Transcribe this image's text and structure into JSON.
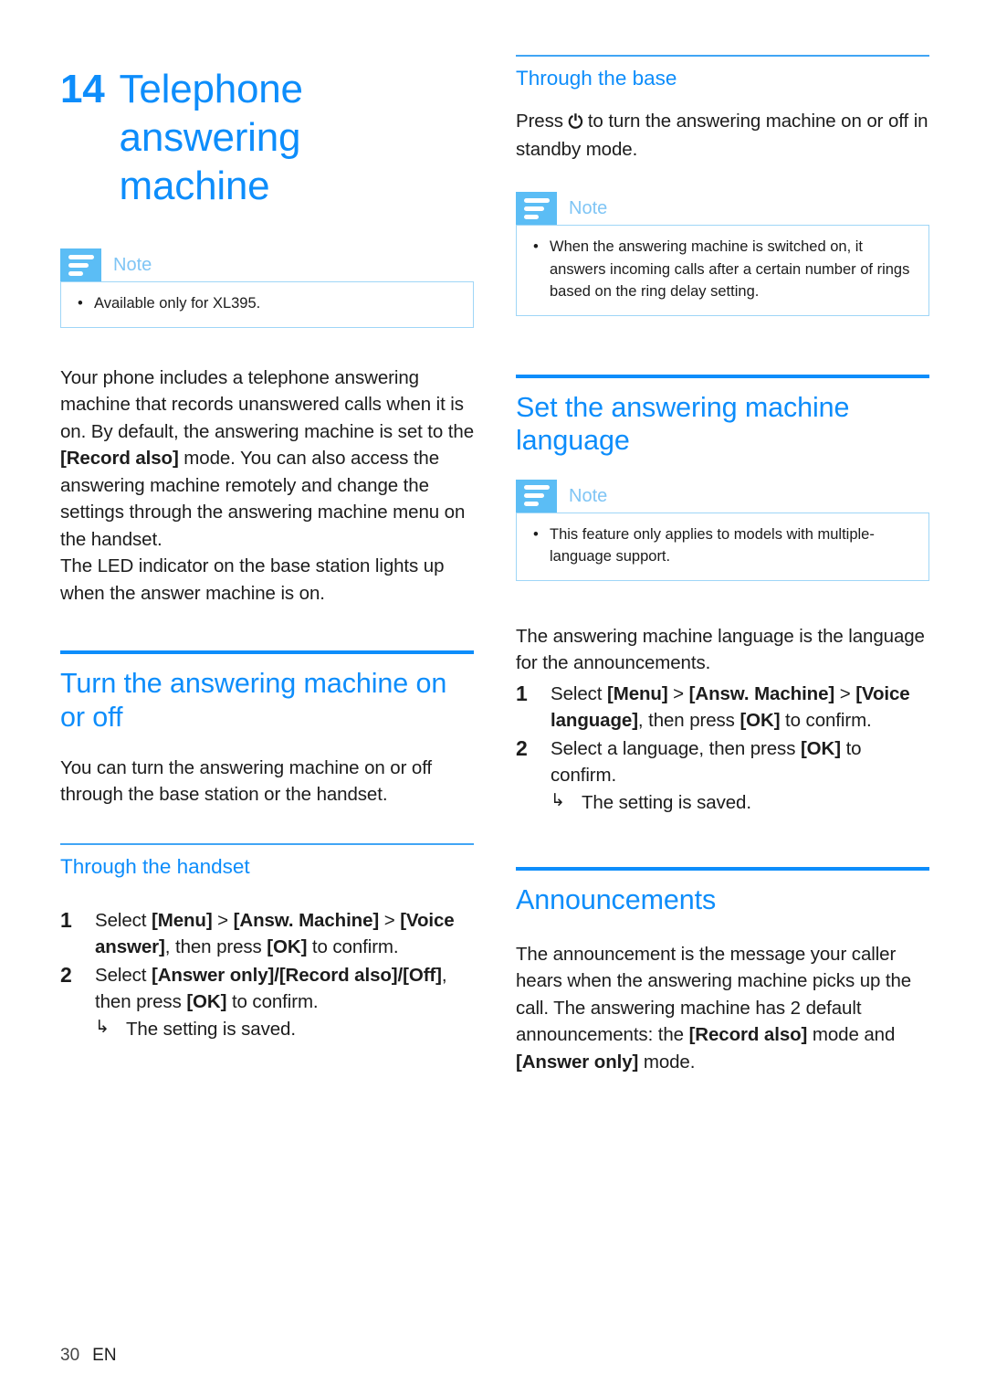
{
  "meta": {
    "accent_blue": "#0d8dfb",
    "note_label_blue": "#7fc5f5",
    "note_icon_blue": "#5bbdf5",
    "note_border_blue": "#9fd6f7",
    "body_text": "#1c1c1c"
  },
  "chapter": {
    "number": "14",
    "title_line1": "Telephone",
    "title_line2": "answering",
    "title_line3": "machine"
  },
  "notes": {
    "label": "Note",
    "chapter_note": "Available only for XL395.",
    "base_note": "When the answering machine is switched on, it answers incoming calls after a certain number of rings based on the ring delay setting.",
    "language_note": "This feature only applies to models with multiple-language support."
  },
  "intro": {
    "para1_part1": "Your phone includes a telephone answering machine that records unanswered calls when it is on. By default, the answering machine is set to the ",
    "para1_bold": "[Record also]",
    "para1_part2": " mode. You can also access the answering machine remotely and change the settings through the answering machine menu on the handset.",
    "para2": "The LED indicator on the base station lights up when the answer machine is on."
  },
  "turn_on_off": {
    "heading": "Turn the answering machine on or off",
    "intro": "You can turn the answering machine on or off through the base station or the handset.",
    "handset": {
      "subheading": "Through the handset",
      "steps": [
        {
          "num": "1",
          "pre": "Select ",
          "bold1": "[Menu]",
          "mid1": " > ",
          "bold2": "[Answ. Machine]",
          "mid2": " > ",
          "bold3": "[Voice answer]",
          "post": ", then press ",
          "bold4": "[OK]",
          "tail": " to confirm."
        },
        {
          "num": "2",
          "pre": "Select ",
          "bold1": "[Answer only]/[Record also]/[Off]",
          "post": ", then press ",
          "bold4": "[OK]",
          "tail": " to confirm.",
          "result": "The setting is saved."
        }
      ]
    },
    "base": {
      "subheading": "Through the base",
      "press_pre": "Press ",
      "power_icon": "power-icon",
      "press_post": " to turn the answering machine on or off in standby mode."
    }
  },
  "language": {
    "heading": "Set the answering machine language",
    "intro": "The answering machine language is the language for the announcements.",
    "steps": [
      {
        "num": "1",
        "pre": "Select ",
        "bold1": "[Menu]",
        "mid1": " > ",
        "bold2": "[Answ. Machine]",
        "mid2": " > ",
        "bold3": "[Voice language]",
        "post": ", then press ",
        "bold4": "[OK]",
        "tail": " to confirm."
      },
      {
        "num": "2",
        "pre": "Select a language, then press ",
        "bold4": "[OK]",
        "tail": " to confirm.",
        "result": "The setting is saved."
      }
    ]
  },
  "announcements": {
    "heading": "Announcements",
    "para_part1": "The announcement is the message your caller hears when the answering machine picks up the call. The answering machine has 2 default announcements: the ",
    "bold1": "[Record also]",
    "para_part2": " mode and ",
    "bold2": "[Answer only]",
    "para_part3": " mode."
  },
  "footer": {
    "page_number": "30",
    "language_code": "EN"
  },
  "symbols": {
    "arrow": "↳",
    "bullet": "•",
    "power": "⏻"
  }
}
